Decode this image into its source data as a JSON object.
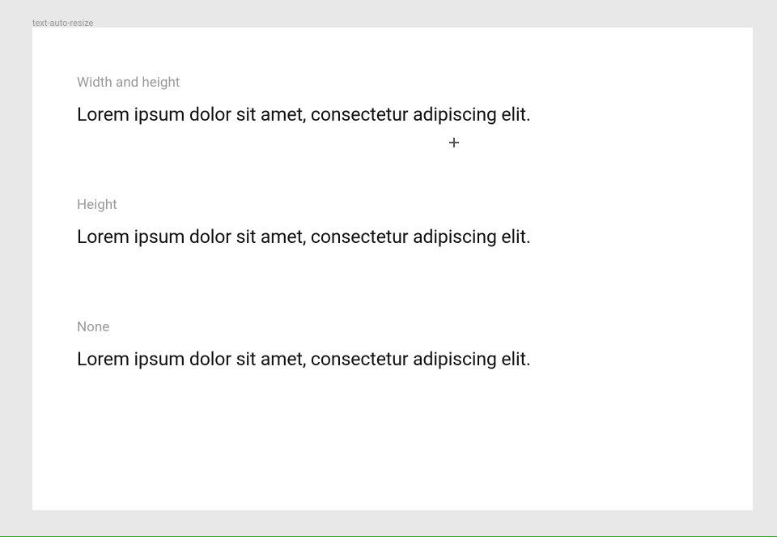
{
  "frame": {
    "title": "text-auto-resize"
  },
  "sections": [
    {
      "label": "Width and height",
      "text": "Lorem ipsum dolor sit amet, consectetur adipiscing elit."
    },
    {
      "label": "Height",
      "text": "Lorem ipsum dolor sit amet, consectetur adipiscing elit."
    },
    {
      "label": "None",
      "text": "Lorem ipsum dolor sit amet, consectetur adipiscing elit."
    }
  ]
}
